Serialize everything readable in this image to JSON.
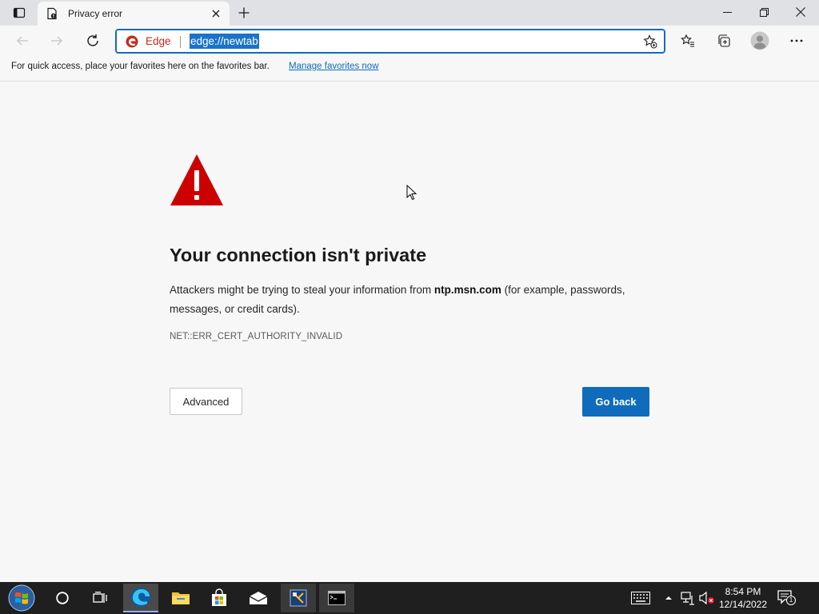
{
  "tab": {
    "title": "Privacy error"
  },
  "address_bar": {
    "site_label": "Edge",
    "url": "edge://newtab"
  },
  "favorites_bar": {
    "text": "For quick access, place your favorites here on the favorites bar.",
    "link": "Manage favorites now"
  },
  "error_page": {
    "heading": "Your connection isn't private",
    "desc_before": "Attackers might be trying to steal your information from ",
    "desc_host": "ntp.msn.com",
    "desc_after": " (for example, passwords, messages, or credit cards).",
    "error_code": "NET::ERR_CERT_AUTHORITY_INVALID",
    "advanced_label": "Advanced",
    "go_back_label": "Go back",
    "warning_icon_color": "#cc0000"
  },
  "taskbar": {
    "time": "8:54 PM",
    "date": "12/14/2022",
    "notification_count": "1"
  },
  "colors": {
    "accent": "#0f6cbd",
    "background": "#f7f7f7"
  }
}
